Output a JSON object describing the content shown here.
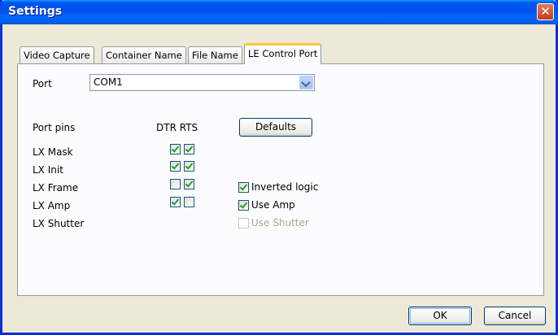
{
  "window": {
    "title": "Settings",
    "close_symbol": "✕"
  },
  "tabs": [
    {
      "label": "Video Capture",
      "active": false
    },
    {
      "label": "Container Name",
      "active": false
    },
    {
      "label": "File Name",
      "active": false
    },
    {
      "label": "LE Control Port",
      "active": true
    }
  ],
  "port": {
    "label": "Port",
    "value": "COM1"
  },
  "pins": {
    "header_label": "Port pins",
    "columns_label": "DTR RTS",
    "defaults_button": "Defaults",
    "rows": [
      {
        "label": "LX Mask",
        "dtr": true,
        "rts": true
      },
      {
        "label": "LX Init",
        "dtr": true,
        "rts": true
      },
      {
        "label": "LX Frame",
        "dtr": false,
        "rts": true
      },
      {
        "label": "LX Amp",
        "dtr": true,
        "rts": false
      },
      {
        "label": "LX Shutter"
      }
    ]
  },
  "options": [
    {
      "label": "Inverted logic",
      "checked": true,
      "enabled": true
    },
    {
      "label": "Use Amp",
      "checked": true,
      "enabled": true
    },
    {
      "label": "Use Shutter",
      "checked": false,
      "enabled": false
    }
  ],
  "footer": {
    "ok_label": "OK",
    "cancel_label": "Cancel"
  },
  "icons": {
    "close": "close-icon",
    "dropdown": "chevron-down-icon",
    "check": "checkmark-icon"
  },
  "colors": {
    "titlebar": "#0054e3",
    "tab_highlight": "#ffc83c",
    "checkmark": "#21a121",
    "close": "#c43c1b"
  }
}
